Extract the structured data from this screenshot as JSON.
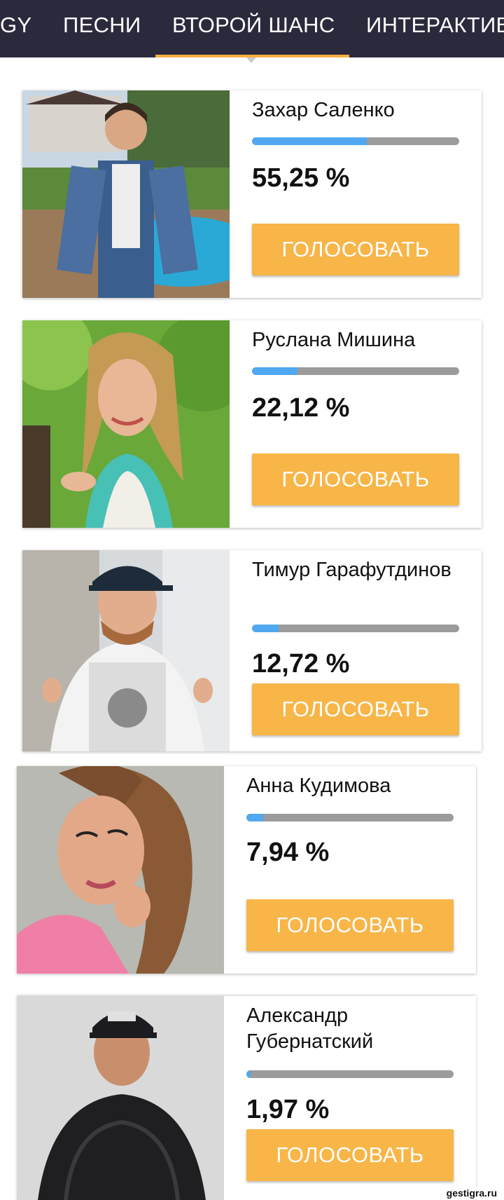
{
  "tabs": [
    {
      "label": "GY"
    },
    {
      "label": "ПЕСНИ"
    },
    {
      "label": "ВТОРОЙ ШАНС",
      "active": true
    },
    {
      "label": "ИНТЕРАКТИВ"
    }
  ],
  "colors": {
    "topbar": "#2b2a3d",
    "accent": "#f8b548",
    "progress_fill": "#4fa8f0",
    "progress_track": "#9b9b9b"
  },
  "candidates": [
    {
      "name": "Захар Саленко",
      "percent_label": "55,25 %",
      "percent": 55.25,
      "vote_label": "ГОЛОСОВАТЬ"
    },
    {
      "name": "Руслана Мишина",
      "percent_label": "22,12 %",
      "percent": 22.12,
      "vote_label": "ГОЛОСОВАТЬ"
    },
    {
      "name": "Тимур Гарафутдинов",
      "percent_label": "12,72 %",
      "percent": 12.72,
      "vote_label": "ГОЛОСОВАТЬ"
    },
    {
      "name": "Анна Кудимова",
      "percent_label": "7,94 %",
      "percent": 7.94,
      "vote_label": "ГОЛОСОВАТЬ"
    },
    {
      "name": "Александр Губернатский",
      "percent_label": "1,97 %",
      "percent": 1.97,
      "vote_label": "ГОЛОСОВАТЬ"
    }
  ],
  "watermark": "gestigra.ru"
}
